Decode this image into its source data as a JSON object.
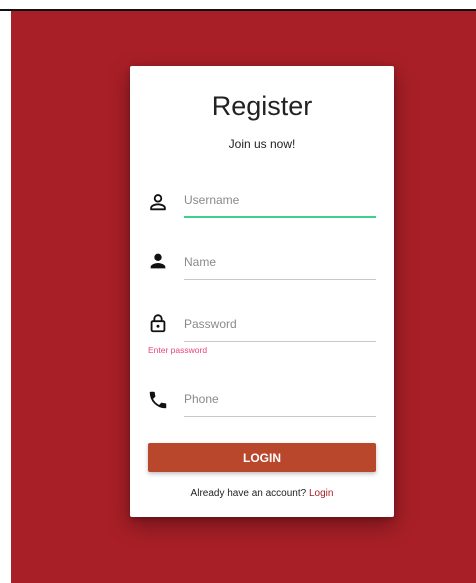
{
  "form": {
    "title": "Register",
    "subtitle": "Join us now!",
    "fields": {
      "username": {
        "icon": "person-outline-icon",
        "placeholder": "Username",
        "value": ""
      },
      "name": {
        "icon": "person-icon",
        "placeholder": "Name",
        "value": ""
      },
      "password": {
        "icon": "lock-icon",
        "placeholder": "Password",
        "value": "",
        "error": "Enter password"
      },
      "phone": {
        "icon": "phone-icon",
        "placeholder": "Phone",
        "value": ""
      }
    },
    "submit_label": "LOGIN",
    "footer_text": "Already have an account? ",
    "footer_link": "Login"
  },
  "colors": {
    "background": "#a81f27",
    "button": "#b8472b",
    "active_underline": "#3fd18c",
    "error": "#e8457a",
    "link": "#a81f27"
  }
}
